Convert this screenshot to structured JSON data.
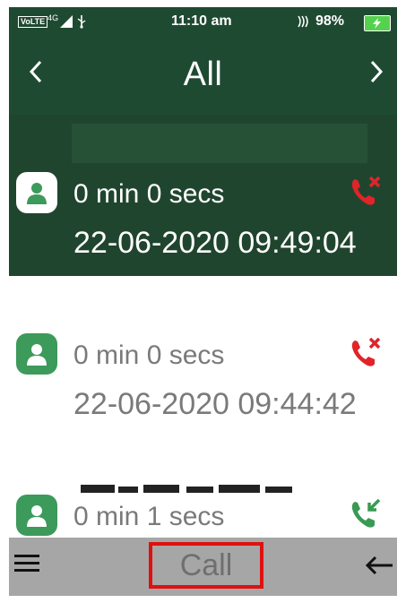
{
  "status_bar": {
    "network_label": "VoLTE",
    "network_gen": "4G",
    "time": "11:10 am",
    "battery_percent": "98%",
    "battery_level": 0.98,
    "battery_color": "#54d24d"
  },
  "header": {
    "title": "All",
    "prev_icon": "chevron-left-icon",
    "next_icon": "chevron-right-icon",
    "background": "#1f4a32"
  },
  "call_log": [
    {
      "duration": "0 min 0 secs",
      "timestamp": "22-06-2020 09:49:04",
      "call_type": "missed",
      "call_icon": "missed-call-icon",
      "selected": true
    },
    {
      "duration": "0 min 0 secs",
      "timestamp": "22-06-2020 09:44:42",
      "call_type": "missed",
      "call_icon": "missed-call-icon",
      "selected": false
    },
    {
      "duration": "0 min 1 secs",
      "timestamp": "",
      "call_type": "incoming",
      "call_icon": "incoming-call-icon",
      "selected": false
    }
  ],
  "softkeys": {
    "left_icon": "menu-icon",
    "center_label": "Call",
    "right_icon": "back-arrow-icon"
  },
  "colors": {
    "accent_green": "#3c9a5a",
    "missed_red": "#e0242a",
    "incoming_green": "#3a9a55",
    "softkey_bar": "#a6a6a6",
    "highlight_border": "#e01010"
  }
}
